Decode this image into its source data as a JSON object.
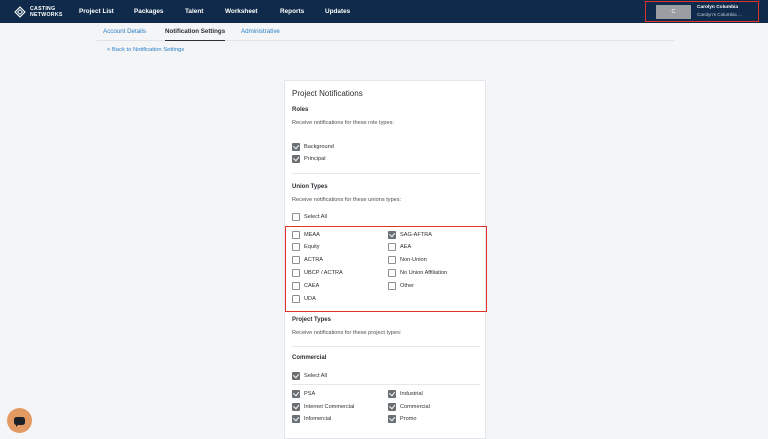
{
  "nav": {
    "logo_text": "CASTING NETWORKS",
    "items": [
      "Project List",
      "Packages",
      "Talent",
      "Worksheet",
      "Reports",
      "Updates"
    ],
    "user": {
      "avatar_letter": "C",
      "name": "Carolyn Columbia",
      "subtitle": "Carolyn's Columbia ..."
    }
  },
  "tabs": [
    "Account Details",
    "Notification Settings",
    "Administrative"
  ],
  "back_link": "< Back to Notification Settings",
  "card": {
    "title": "Project Notifications",
    "roles": {
      "title": "Roles",
      "desc": "Receive notifications for these role types:",
      "options": [
        {
          "label": "Background",
          "checked": true
        },
        {
          "label": "Principal",
          "checked": true
        }
      ]
    },
    "union": {
      "title": "Union Types",
      "desc": "Receive notifications for these unions types:",
      "select_all": {
        "label": "Select All",
        "checked": false
      },
      "left": [
        {
          "label": "MEAA",
          "checked": false
        },
        {
          "label": "Equity",
          "checked": false
        },
        {
          "label": "ACTRA",
          "checked": false
        },
        {
          "label": "UBCP / ACTRA",
          "checked": false
        },
        {
          "label": "CAEA",
          "checked": false
        },
        {
          "label": "UDA",
          "checked": false
        }
      ],
      "right": [
        {
          "label": "SAG-AFTRA",
          "checked": true
        },
        {
          "label": "AEA",
          "checked": false
        },
        {
          "label": "Non-Union",
          "checked": false
        },
        {
          "label": "No Union Affiliation",
          "checked": false
        },
        {
          "label": "Other",
          "checked": false
        }
      ]
    },
    "project_types": {
      "title": "Project Types",
      "desc": "Receive notifications for these project types:"
    },
    "commercial": {
      "title": "Commercial",
      "select_all": {
        "label": "Select All",
        "checked": true
      },
      "left": [
        {
          "label": "PSA",
          "checked": true
        },
        {
          "label": "Internet Commercial",
          "checked": true
        },
        {
          "label": "Infomercial",
          "checked": true
        }
      ],
      "right": [
        {
          "label": "Industrial",
          "checked": true
        },
        {
          "label": "Commercial",
          "checked": true
        },
        {
          "label": "Promo",
          "checked": true
        }
      ]
    }
  },
  "colors": {
    "nav_bg": "#0f2a4a",
    "link": "#2b7fc6",
    "highlight": "#e0342a",
    "chat": "#e39a62"
  }
}
